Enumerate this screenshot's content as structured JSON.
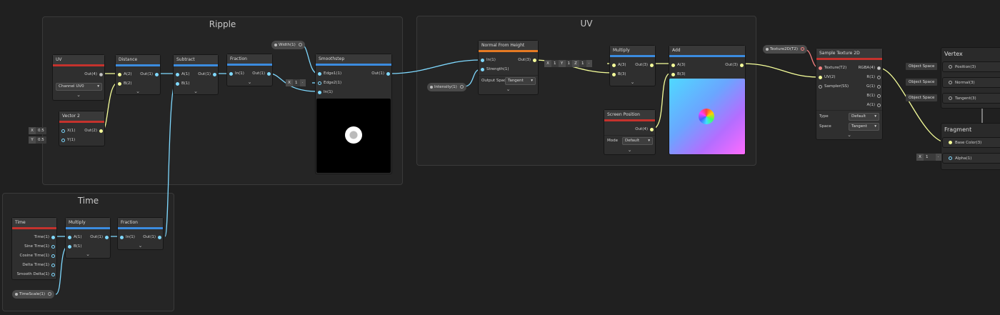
{
  "groups": {
    "ripple": "Ripple",
    "uv": "UV",
    "time": "Time",
    "vertex": "Vertex",
    "fragment": "Fragment"
  },
  "nodes": {
    "uv": {
      "title": "UV",
      "out": "Out(4)",
      "channel": "Channel UV0"
    },
    "vector2": {
      "title": "Vector 2",
      "x": "X(1)",
      "y": "Y(1)",
      "out": "Out(2)",
      "x_axis": "X",
      "x_val": "0.5",
      "y_axis": "Y",
      "y_val": "0.5"
    },
    "distance": {
      "title": "Distance",
      "a": "A(2)",
      "b": "B(2)",
      "out": "Out(1)"
    },
    "subtract": {
      "title": "Subtract",
      "a": "A(1)",
      "b": "B(1)",
      "out": "Out(1)"
    },
    "fraction1": {
      "title": "Fraction",
      "in": "In(1)",
      "out": "Out(1)"
    },
    "width": {
      "label": "Width(1)"
    },
    "edge2": {
      "axis": "X",
      "val": "1"
    },
    "smoothstep": {
      "title": "Smoothstep",
      "edge1": "Edge1(1)",
      "edge2": "Edge2(1)",
      "in": "In(1)",
      "out": "Out(1)"
    },
    "intensity": {
      "label": "Intensity(1)"
    },
    "normal": {
      "title": "Normal From Height",
      "in": "In(1)",
      "strength": "Strength(1)",
      "out": "Out(3)",
      "space_label": "Output Space",
      "space": "Tangent"
    },
    "vec3": {
      "x": "X",
      "xv": "1",
      "y": "Y",
      "yv": "1",
      "z": "Z",
      "zv": "1"
    },
    "multiply2": {
      "title": "Multiply",
      "a": "A(3)",
      "b": "B(3)",
      "out": "Out(3)"
    },
    "add": {
      "title": "Add",
      "a": "A(3)",
      "b": "B(3)",
      "out": "Out(3)"
    },
    "screenpos": {
      "title": "Screen Position",
      "out": "Out(4)",
      "mode_label": "Mode",
      "mode": "Default"
    },
    "tex2d": {
      "label": "Texture2D(T2)"
    },
    "sample": {
      "title": "Sample Texture 2D",
      "tex": "Texture(T2)",
      "uv": "UV(2)",
      "sampler": "Sampler(SS)",
      "rgba": "RGBA(4)",
      "r": "R(1)",
      "g": "G(1)",
      "b": "B(1)",
      "a": "A(1)",
      "type_label": "Type",
      "type": "Default",
      "space_label": "Space",
      "space": "Tangent"
    },
    "vertex": {
      "position": "Position(3)",
      "normal": "Normal(3)",
      "tangent": "Tangent(3)",
      "obj": "Object Space"
    },
    "fragment": {
      "base": "Base Color(3)",
      "alpha": "Alpha(1)",
      "alpha_axis": "X",
      "alpha_val": "1"
    },
    "time": {
      "title": "Time",
      "t": "Time(1)",
      "sine": "Sine Time(1)",
      "cos": "Cosine Time(1)",
      "delta": "Delta Time(1)",
      "smooth": "Smooth Delta(1)"
    },
    "multiply1": {
      "title": "Multiply",
      "a": "A(1)",
      "b": "B(1)",
      "out": "Out(1)"
    },
    "fraction2": {
      "title": "Fraction",
      "in": "In(1)",
      "out": "Out(1)"
    },
    "timescale": {
      "label": "TimeScale(1)"
    }
  }
}
